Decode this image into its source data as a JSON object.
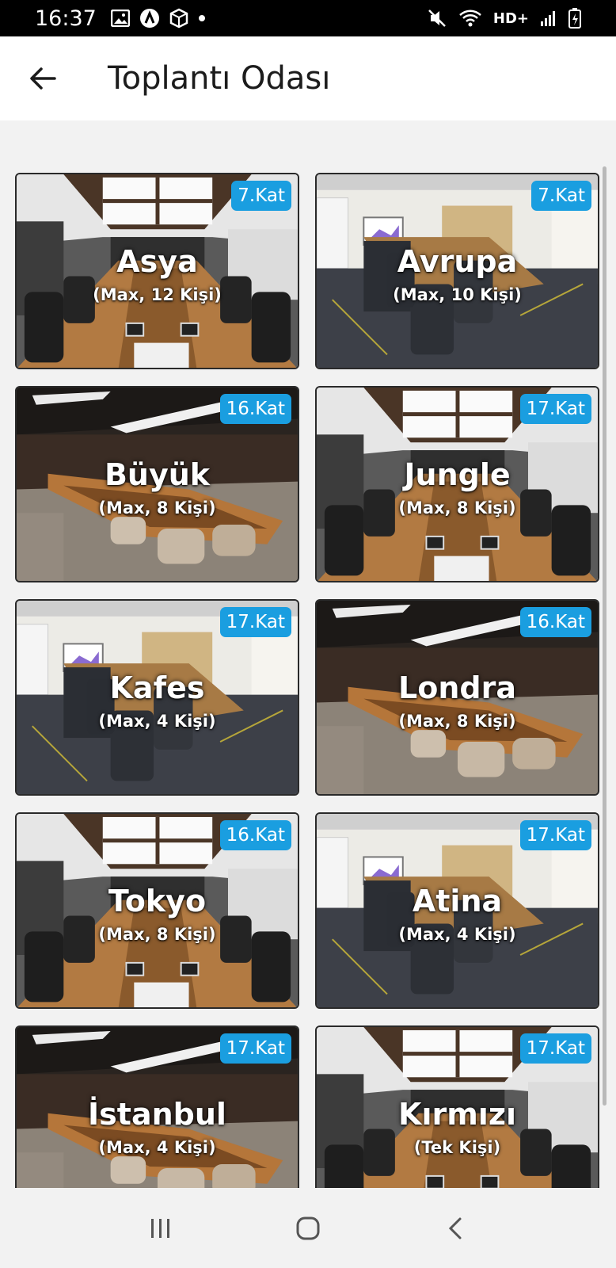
{
  "status": {
    "time": "16:37",
    "network": "HD+",
    "icons_left": [
      "image-icon",
      "app-icon",
      "box-icon",
      "dot-icon"
    ],
    "icons_right": [
      "mute-icon",
      "wifi-icon",
      "signal-icon",
      "battery-charging-icon"
    ]
  },
  "appbar": {
    "title": "Toplantı Odası",
    "back_icon": "arrow-left-icon"
  },
  "rooms": [
    {
      "name": "Asya",
      "capacity": "(Max, 12 Kişi)",
      "floor": "7.Kat",
      "style": "white-ceiling"
    },
    {
      "name": "Avrupa",
      "capacity": "(Max, 10 Kişi)",
      "floor": "7.Kat",
      "style": "carpet-room"
    },
    {
      "name": "Büyük",
      "capacity": "(Max, 8 Kişi)",
      "floor": "16.Kat",
      "style": "dark-wood"
    },
    {
      "name": "Jungle",
      "capacity": "(Max, 8 Kişi)",
      "floor": "17.Kat",
      "style": "white-ceiling"
    },
    {
      "name": "Kafes",
      "capacity": "(Max, 4 Kişi)",
      "floor": "17.Kat",
      "style": "carpet-room"
    },
    {
      "name": "Londra",
      "capacity": "(Max, 8 Kişi)",
      "floor": "16.Kat",
      "style": "dark-wood"
    },
    {
      "name": "Tokyo",
      "capacity": "(Max, 8 Kişi)",
      "floor": "16.Kat",
      "style": "white-ceiling"
    },
    {
      "name": "Atina",
      "capacity": "(Max, 4 Kişi)",
      "floor": "17.Kat",
      "style": "carpet-room"
    },
    {
      "name": "İstanbul",
      "capacity": "(Max, 4 Kişi)",
      "floor": "17.Kat",
      "style": "dark-wood"
    },
    {
      "name": "Kırmızı",
      "capacity": "(Tek Kişi)",
      "floor": "17.Kat",
      "style": "white-ceiling"
    }
  ],
  "navbar": {
    "icons": [
      "recent-apps-icon",
      "home-icon",
      "back-icon"
    ]
  },
  "colors": {
    "badge": "#1a9ee0",
    "statusbar": "#000000",
    "background": "#f2f2f2"
  }
}
